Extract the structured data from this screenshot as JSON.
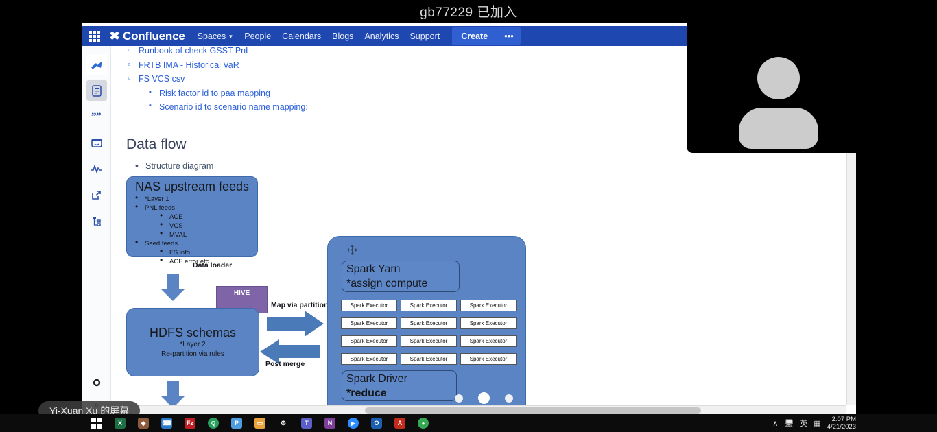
{
  "meeting": {
    "banner_text": "gb77229 已加入",
    "share_label": "Yi-Xuan Xu 的屏幕",
    "participant_avatar": "person-avatar-icon"
  },
  "confluence": {
    "app_switcher_icon": "app-grid-icon",
    "brand": "Confluence",
    "brand_mark": "✖",
    "nav_links": [
      {
        "label": "Spaces",
        "has_caret": true
      },
      {
        "label": "People",
        "has_caret": false
      },
      {
        "label": "Calendars",
        "has_caret": false
      },
      {
        "label": "Blogs",
        "has_caret": false
      },
      {
        "label": "Analytics",
        "has_caret": false
      },
      {
        "label": "Support",
        "has_caret": false
      }
    ],
    "create_label": "Create",
    "more_label": "•••",
    "sidebar_icons": [
      "confluence-logo-icon",
      "page-document-icon",
      "quote-icon",
      "calendar-icon",
      "analytics-icon",
      "external-link-icon",
      "page-tree-icon"
    ],
    "settings_icon": "gear-icon",
    "expand_icon": "»"
  },
  "document": {
    "top_list": [
      {
        "level": 2,
        "text": "Runbook of check GSST PnL"
      },
      {
        "level": 2,
        "text": "FRTB IMA - Historical VaR"
      },
      {
        "level": 2,
        "text": "FS VCS csv"
      },
      {
        "level": 3,
        "text": "Risk factor id to paa mapping"
      },
      {
        "level": 3,
        "text": "Scenario id to scenario name mapping:"
      }
    ],
    "heading": "Data flow",
    "subbullet": "Structure diagram"
  },
  "diagram": {
    "nas": {
      "title": "NAS upstream feeds",
      "items": [
        {
          "level": 1,
          "text": "*Layer 1"
        },
        {
          "level": 1,
          "text": "PNL feeds"
        },
        {
          "level": 2,
          "text": "ACE"
        },
        {
          "level": 2,
          "text": "VCS"
        },
        {
          "level": 2,
          "text": "MVAL"
        },
        {
          "level": 1,
          "text": "Seed feeds"
        },
        {
          "level": 2,
          "text": "FS info"
        },
        {
          "level": 2,
          "text": "ACE error etc"
        }
      ]
    },
    "hdfs": {
      "title": "HDFS schemas",
      "sub1": "*Layer 2",
      "sub2": "Re-partition via rules"
    },
    "hive": {
      "label": "HIVE"
    },
    "labels": {
      "data_loader": "Data loader",
      "map_via_partition": "Map via partition",
      "post_merge": "Post merge"
    },
    "spark": {
      "move_handle_icon": "move-handle-icon",
      "yarn": {
        "title": "Spark Yarn",
        "sub": "*assign compute"
      },
      "driver": {
        "title": "Spark Driver",
        "sub": "*reduce"
      },
      "executor_label": "Spark Executor",
      "executor_count": 12
    },
    "colors": {
      "box_fill": "#5b84c4",
      "box_stroke": "#3f6aac",
      "hive_fill": "#7f64a8",
      "arrow_fill": "#4a7ab8",
      "executor_fill": "#ffffff"
    }
  },
  "taskbar": {
    "start_icon": "windows-start-icon",
    "apps": [
      {
        "name": "excel-icon",
        "glyph": "X",
        "color": "#1d7044",
        "shape": "sq"
      },
      {
        "name": "paint-3d-icon",
        "glyph": "◆",
        "color": "#8c5a3c",
        "shape": "sq"
      },
      {
        "name": "vscode-icon",
        "glyph": "⌨",
        "color": "#2b7cc4",
        "shape": "sq"
      },
      {
        "name": "filezilla-icon",
        "glyph": "Fz",
        "color": "#bf2025",
        "shape": "sq"
      },
      {
        "name": "green-app-icon",
        "glyph": "Q",
        "color": "#27a05c",
        "shape": "circ"
      },
      {
        "name": "powerpoint-icon",
        "glyph": "P",
        "color": "#4c9ee0",
        "shape": "sq"
      },
      {
        "name": "file-explorer-icon",
        "glyph": "▭",
        "color": "#e8a33d",
        "shape": "sq"
      },
      {
        "name": "settings-gear-icon",
        "glyph": "⚙",
        "color": "#0c0c0c",
        "shape": "sq"
      },
      {
        "name": "ms-teams-icon",
        "glyph": "T",
        "color": "#5b5fc7",
        "shape": "sq"
      },
      {
        "name": "onenote-icon",
        "glyph": "N",
        "color": "#7d3f98",
        "shape": "sq"
      },
      {
        "name": "zoom-icon",
        "glyph": "▶",
        "color": "#2d8cff",
        "shape": "circ"
      },
      {
        "name": "outlook-icon",
        "glyph": "O",
        "color": "#1c5fb0",
        "shape": "sq"
      },
      {
        "name": "pdf-reader-icon",
        "glyph": "A",
        "color": "#c42b1c",
        "shape": "sq"
      },
      {
        "name": "chrome-icon",
        "glyph": "●",
        "color": "#34a853",
        "shape": "circ"
      }
    ],
    "tray": [
      {
        "name": "show-hidden-icons",
        "glyph": "∧"
      },
      {
        "name": "network-icon",
        "glyph": "὚7"
      },
      {
        "name": "ime-language-icon",
        "glyph": "英"
      },
      {
        "name": "action-center-icon",
        "glyph": "▦"
      }
    ],
    "clock": {
      "time": "2:07 PM",
      "date": "4/21/2023"
    }
  }
}
